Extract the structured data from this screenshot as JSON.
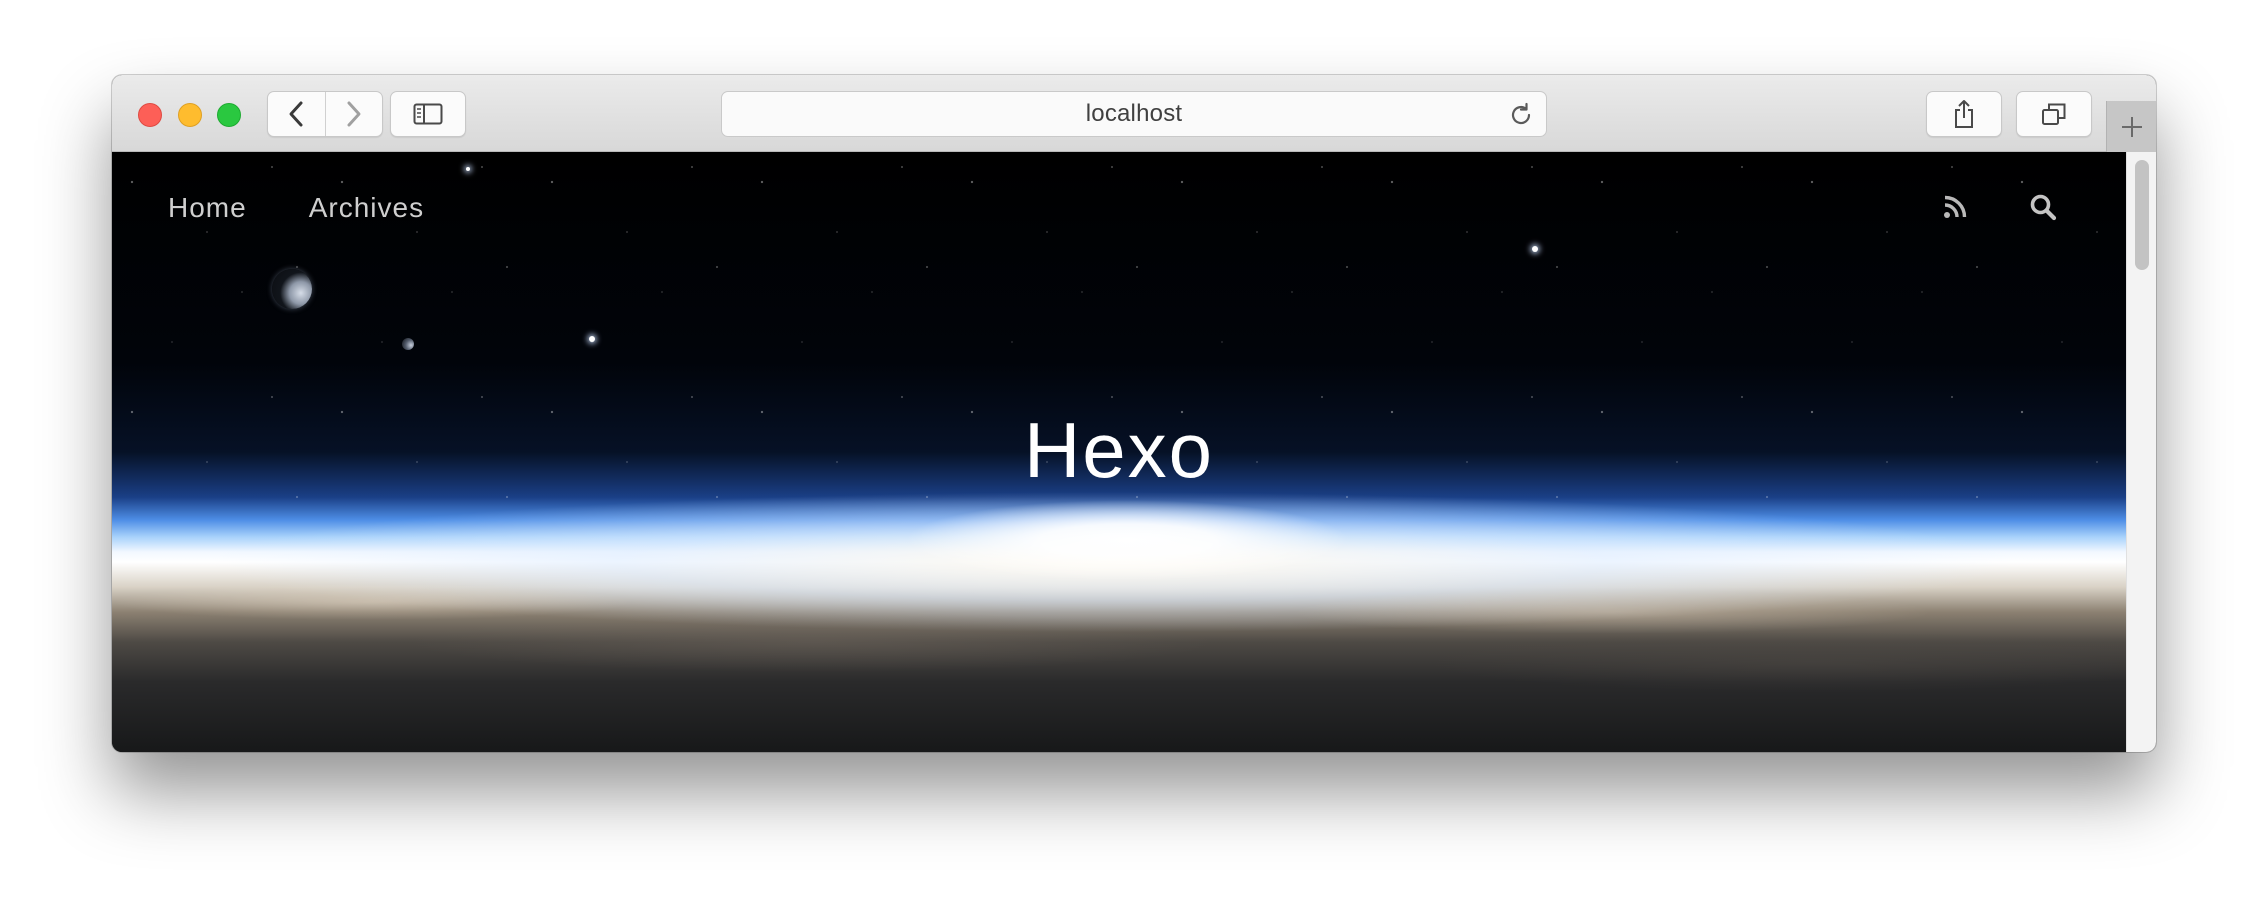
{
  "browser": {
    "address": "localhost",
    "buttons": {
      "back": "chevron-left-icon",
      "forward": "chevron-right-icon",
      "sidebar": "sidebar-icon",
      "reload": "reload-icon",
      "share": "share-icon",
      "tabs": "tabs-icon",
      "new_tab": "plus-icon"
    }
  },
  "site": {
    "nav": [
      {
        "label": "Home"
      },
      {
        "label": "Archives"
      }
    ],
    "icons": [
      "rss-icon",
      "search-icon"
    ],
    "title": "Hexo"
  },
  "colors": {
    "close": "#fd5f57",
    "minimize": "#febc2e",
    "zoom": "#2ac840",
    "nav_text": "#cfcfcf",
    "title_text": "#ffffff"
  }
}
